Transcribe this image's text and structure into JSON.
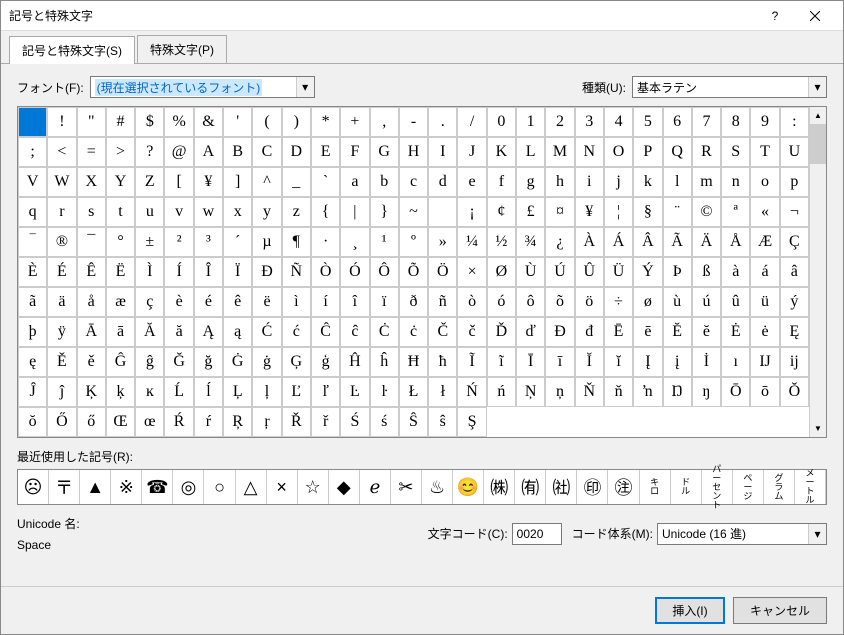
{
  "title": "記号と特殊文字",
  "tabs": {
    "t0": "記号と特殊文字(S)",
    "t1": "特殊文字(P)"
  },
  "fontLabel": "フォント(F):",
  "fontValue": "(現在選択されているフォント)",
  "subsetLabel": "種類(U):",
  "subsetValue": "基本ラテン",
  "grid": [
    [
      " ",
      "!",
      "\"",
      "#",
      "$",
      "%",
      "&",
      "'",
      "(",
      ")",
      "*",
      "+",
      ",",
      "-",
      ".",
      "/",
      "0",
      "1",
      "2",
      "3",
      "4",
      "5",
      "6",
      "7",
      "8",
      "9"
    ],
    [
      ":",
      ";",
      "<",
      "=",
      ">",
      "?",
      "@",
      "A",
      "B",
      "C",
      "D",
      "E",
      "F",
      "G",
      "H",
      "I",
      "J",
      "K",
      "L",
      "M",
      "N",
      "O",
      "P",
      "Q",
      "R",
      "S"
    ],
    [
      "T",
      "U",
      "V",
      "W",
      "X",
      "Y",
      "Z",
      "[",
      "¥",
      "]",
      "^",
      "_",
      "`",
      "a",
      "b",
      "c",
      "d",
      "e",
      "f",
      "g",
      "h",
      "i",
      "j",
      "k",
      "l",
      "m"
    ],
    [
      "n",
      "o",
      "p",
      "q",
      "r",
      "s",
      "t",
      "u",
      "v",
      "w",
      "x",
      "y",
      "z",
      "{",
      "|",
      "}",
      "~",
      " ",
      "¡",
      "¢",
      "£",
      "¤",
      "¥",
      "¦",
      "§",
      "¨"
    ],
    [
      "©",
      "ª",
      "«",
      "¬",
      "‾",
      "®",
      "¯",
      "°",
      "±",
      "²",
      "³",
      "´",
      "µ",
      "¶",
      "·",
      "¸",
      "¹",
      "º",
      "»",
      "¼",
      "½",
      "¾",
      "¿",
      "À",
      "Á",
      "Â"
    ],
    [
      "Ã",
      "Ä",
      "Å",
      "Æ",
      "Ç",
      "È",
      "É",
      "Ê",
      "Ë",
      "Ì",
      "Í",
      "Î",
      "Ï",
      "Ð",
      "Ñ",
      "Ò",
      "Ó",
      "Ô",
      "Õ",
      "Ö",
      "×",
      "Ø",
      "Ù",
      "Ú",
      "Û",
      "Ü"
    ],
    [
      "Ý",
      "Þ",
      "ß",
      "à",
      "á",
      "â",
      "ã",
      "ä",
      "å",
      "æ",
      "ç",
      "è",
      "é",
      "ê",
      "ë",
      "ì",
      "í",
      "î",
      "ï",
      "ð",
      "ñ",
      "ò",
      "ó",
      "ô",
      "õ",
      "ö"
    ],
    [
      "÷",
      "ø",
      "ù",
      "ú",
      "û",
      "ü",
      "ý",
      "þ",
      "ÿ",
      "Ā",
      "ā",
      "Ă",
      "ă",
      "Ą",
      "ą",
      "Ć",
      "ć",
      "Ĉ",
      "ĉ",
      "Ċ",
      "ċ",
      "Č",
      "č",
      "Ď",
      "ď",
      "Đ"
    ],
    [
      "đ",
      "Ē",
      "ē",
      "Ĕ",
      "ĕ",
      "Ė",
      "ė",
      "Ę",
      "ę",
      "Ě",
      "ě",
      "Ĝ",
      "ĝ",
      "Ğ",
      "ğ",
      "Ġ",
      "ġ",
      "Ģ",
      "ģ",
      "Ĥ",
      "ĥ",
      "Ħ",
      "ħ",
      "Ĩ",
      "ĩ",
      "Ī"
    ],
    [
      "ī",
      "Ĭ",
      "ĭ",
      "Į",
      "į",
      "İ",
      "ı",
      "Ĳ",
      "ĳ",
      "Ĵ",
      "ĵ",
      "Ķ",
      "ķ",
      "ĸ",
      "Ĺ",
      "ĺ",
      "Ļ",
      "ļ",
      "Ľ",
      "ľ",
      "Ŀ",
      "ŀ",
      "Ł",
      "ł",
      "Ń",
      "ń"
    ],
    [
      "Ņ",
      "ņ",
      "Ň",
      "ň",
      "ŉ",
      "Ŋ",
      "ŋ",
      "Ō",
      "ō",
      "Ŏ",
      "ŏ",
      "Ő",
      "ő",
      "Œ",
      "œ",
      "Ŕ",
      "ŕ",
      "Ŗ",
      "ŗ",
      "Ř",
      "ř",
      "Ś",
      "ś",
      "Ŝ",
      "ŝ",
      "Ş"
    ]
  ],
  "recentLabel": "最近使用した記号(R):",
  "recent": [
    "☹",
    "〒",
    "▲",
    "※",
    "☎",
    "◎",
    "○",
    "△",
    "×",
    "☆",
    "◆",
    "ℯ",
    "✂",
    "♨",
    "😊",
    "㈱",
    "㈲",
    "㈳",
    "㊞",
    "㊟"
  ],
  "recentSmall": [
    "キロ",
    "ドル",
    "パーセント",
    "ページ",
    "グラム",
    "メートル"
  ],
  "unicodeNameLabel": "Unicode 名:",
  "unicodeName": "Space",
  "codeLabel": "文字コード(C):",
  "codeValue": "0020",
  "fromLabel": "コード体系(M):",
  "fromValue": "Unicode (16 進)",
  "insertBtn": "挿入(I)",
  "cancelBtn": "キャンセル"
}
